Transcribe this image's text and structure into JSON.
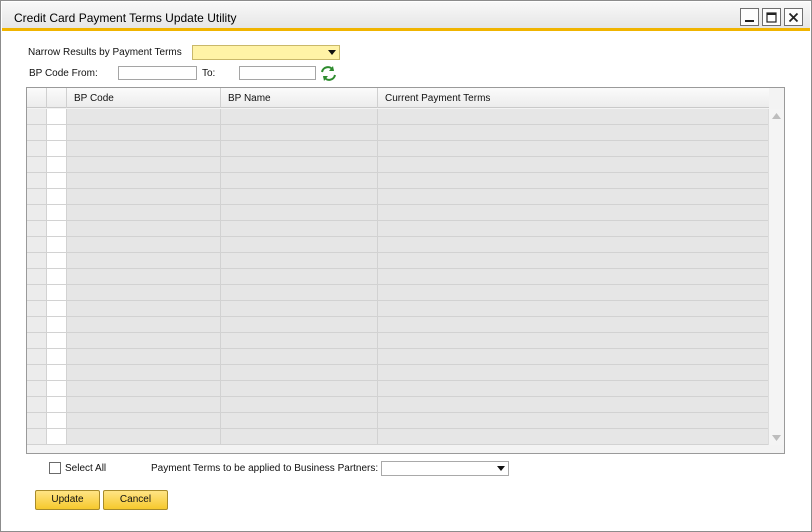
{
  "window": {
    "title": "Credit Card Payment Terms Update Utility",
    "controls": [
      "minimize-icon",
      "maximize-icon",
      "close-icon"
    ]
  },
  "filters": {
    "narrow_label": "Narrow Results by Payment Terms",
    "narrow_value": "",
    "bp_from_label": "BP Code From:",
    "bp_from_value": "",
    "to_label": "To:",
    "to_value": "",
    "refresh_icon": "refresh-icon"
  },
  "grid": {
    "columns": [
      "BP Code",
      "BP Name",
      "Current Payment Terms"
    ],
    "rows": []
  },
  "footer": {
    "select_all_label": "Select All",
    "select_all_checked": false,
    "apply_terms_label": "Payment Terms to be applied to Business Partners:",
    "apply_terms_value": ""
  },
  "buttons": {
    "update_label": "Update",
    "cancel_label": "Cancel"
  },
  "colors": {
    "accent": "#f0b400",
    "button": "#f6c92d",
    "combo_highlight": "#fff3a6"
  }
}
